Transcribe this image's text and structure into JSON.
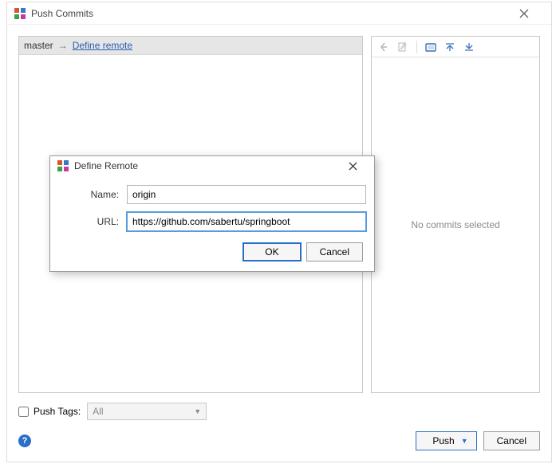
{
  "outer": {
    "title": "Push Commits",
    "branch": "master",
    "arrow": "→",
    "defineRemote": "Define remote",
    "pushTagsLabel": "Push Tags:",
    "tagsCombo": "All",
    "pushBtn": "Push",
    "cancelBtn": "Cancel",
    "noCommits": "No commits selected"
  },
  "inner": {
    "title": "Define Remote",
    "nameLabel": "Name:",
    "nameValue": "origin",
    "urlLabel": "URL:",
    "urlValue": "https://github.com/sabertu/springboot",
    "okBtn": "OK",
    "cancelBtn": "Cancel"
  }
}
